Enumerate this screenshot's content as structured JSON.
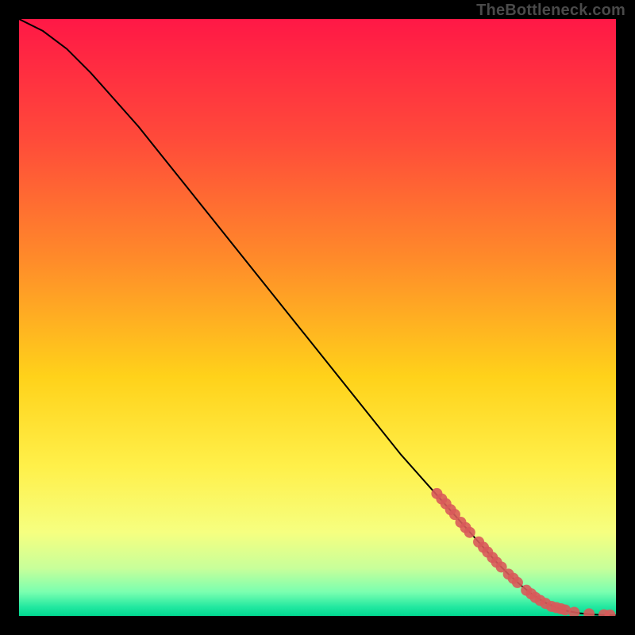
{
  "watermark": "TheBottleneck.com",
  "colors": {
    "frame": "#000000",
    "watermark": "#4a4a4a",
    "curve": "#000000",
    "marker": "#d85a5a",
    "gradient_stops": [
      {
        "offset": 0.0,
        "color": "#ff1846"
      },
      {
        "offset": 0.2,
        "color": "#ff4a3a"
      },
      {
        "offset": 0.4,
        "color": "#ff8a2a"
      },
      {
        "offset": 0.6,
        "color": "#ffd21a"
      },
      {
        "offset": 0.75,
        "color": "#fff04a"
      },
      {
        "offset": 0.86,
        "color": "#f6ff80"
      },
      {
        "offset": 0.92,
        "color": "#c8ff9a"
      },
      {
        "offset": 0.96,
        "color": "#7affb0"
      },
      {
        "offset": 0.985,
        "color": "#22e8a0"
      },
      {
        "offset": 1.0,
        "color": "#00d890"
      }
    ]
  },
  "chart_data": {
    "type": "line",
    "title": "",
    "xlabel": "",
    "ylabel": "",
    "xlim": [
      0,
      100
    ],
    "ylim": [
      0,
      100
    ],
    "series": [
      {
        "name": "curve",
        "x": [
          0,
          4,
          8,
          12,
          16,
          20,
          24,
          28,
          32,
          36,
          40,
          44,
          48,
          52,
          56,
          60,
          64,
          68,
          72,
          76,
          80,
          82,
          84,
          86,
          88,
          90,
          92,
          94,
          96,
          98,
          100
        ],
        "y": [
          100,
          98,
          95,
          91,
          86.5,
          82,
          77,
          72,
          67,
          62,
          57,
          52,
          47,
          42,
          37,
          32,
          27,
          22.5,
          18,
          13.5,
          9,
          7,
          5.2,
          3.6,
          2.3,
          1.4,
          0.8,
          0.45,
          0.25,
          0.15,
          0.1
        ]
      }
    ],
    "markers": [
      {
        "x": 70.0,
        "y": 20.5
      },
      {
        "x": 70.8,
        "y": 19.6
      },
      {
        "x": 71.5,
        "y": 18.8
      },
      {
        "x": 72.3,
        "y": 17.8
      },
      {
        "x": 73.0,
        "y": 17.0
      },
      {
        "x": 74.0,
        "y": 15.7
      },
      {
        "x": 74.8,
        "y": 14.8
      },
      {
        "x": 75.5,
        "y": 14.0
      },
      {
        "x": 77.0,
        "y": 12.4
      },
      {
        "x": 77.8,
        "y": 11.5
      },
      {
        "x": 78.5,
        "y": 10.7
      },
      {
        "x": 79.3,
        "y": 9.8
      },
      {
        "x": 80.0,
        "y": 9.0
      },
      {
        "x": 80.8,
        "y": 8.2
      },
      {
        "x": 82.0,
        "y": 7.0
      },
      {
        "x": 82.8,
        "y": 6.3
      },
      {
        "x": 83.5,
        "y": 5.6
      },
      {
        "x": 85.0,
        "y": 4.3
      },
      {
        "x": 85.8,
        "y": 3.7
      },
      {
        "x": 86.5,
        "y": 3.1
      },
      {
        "x": 87.3,
        "y": 2.6
      },
      {
        "x": 88.2,
        "y": 2.1
      },
      {
        "x": 89.2,
        "y": 1.6
      },
      {
        "x": 90.0,
        "y": 1.4
      },
      {
        "x": 90.8,
        "y": 1.2
      },
      {
        "x": 91.5,
        "y": 1.0
      },
      {
        "x": 93.0,
        "y": 0.6
      },
      {
        "x": 95.5,
        "y": 0.35
      },
      {
        "x": 98.0,
        "y": 0.2
      },
      {
        "x": 99.0,
        "y": 0.15
      }
    ]
  }
}
